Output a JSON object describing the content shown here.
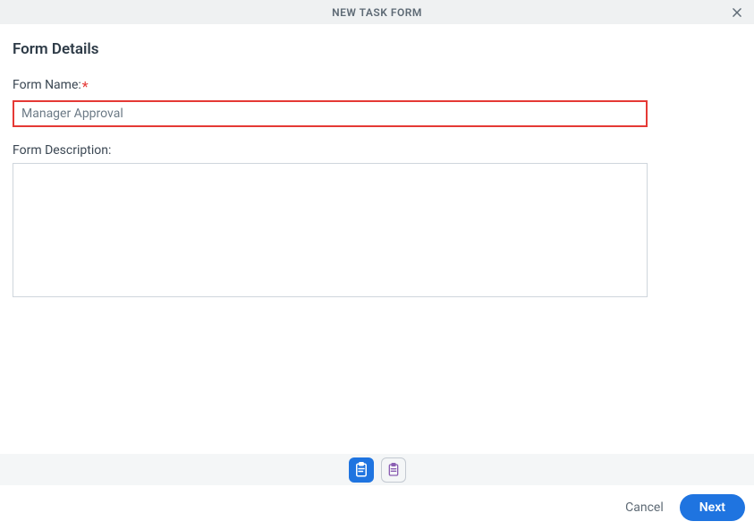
{
  "header": {
    "title": "NEW TASK FORM"
  },
  "section": {
    "title": "Form Details"
  },
  "fields": {
    "form_name": {
      "label": "Form Name:",
      "value": "Manager Approval"
    },
    "form_description": {
      "label": "Form Description:",
      "value": ""
    }
  },
  "footer": {
    "cancel": "Cancel",
    "next": "Next"
  }
}
